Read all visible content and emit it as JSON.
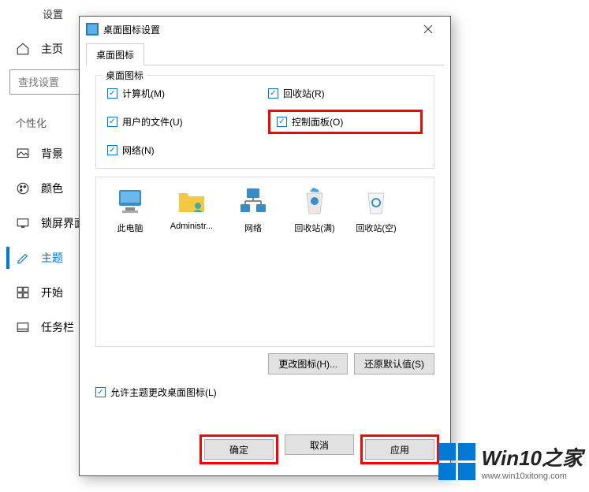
{
  "settings": {
    "title": "设置",
    "home": "主页",
    "searchPlaceholder": "查找设置",
    "section": "个性化",
    "nav": [
      {
        "label": "背景"
      },
      {
        "label": "颜色"
      },
      {
        "label": "锁屏界面"
      },
      {
        "label": "主题"
      },
      {
        "label": "开始"
      },
      {
        "label": "任务栏"
      }
    ]
  },
  "dialog": {
    "title": "桌面图标设置",
    "tab": "桌面图标",
    "groupLabel": "桌面图标",
    "checkboxes": {
      "computer": "计算机(M)",
      "recycle": "回收站(R)",
      "userfiles": "用户的文件(U)",
      "control": "控制面板(O)",
      "network": "网络(N)"
    },
    "icons": [
      {
        "label": "此电脑"
      },
      {
        "label": "Administr..."
      },
      {
        "label": "网络"
      },
      {
        "label": "回收站(满)"
      },
      {
        "label": "回收站(空)"
      }
    ],
    "changeIcon": "更改图标(H)...",
    "restoreDefault": "还原默认值(S)",
    "allowThemes": "允许主题更改桌面图标(L)",
    "ok": "确定",
    "cancel": "取消",
    "apply": "应用"
  },
  "watermark": {
    "brand": "Win10之家",
    "url": "www.win10xitong.com"
  }
}
